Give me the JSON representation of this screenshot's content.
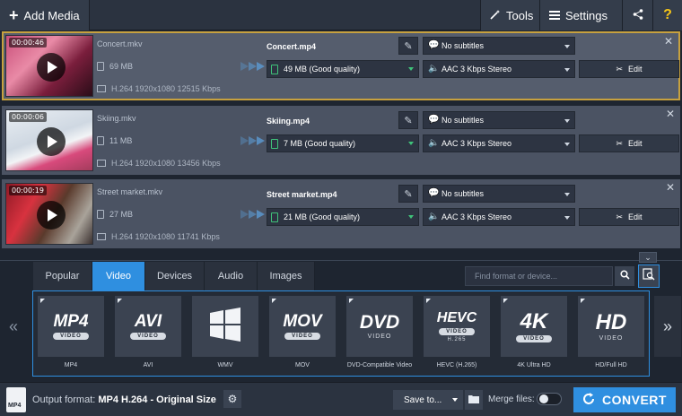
{
  "toolbar": {
    "add_media": "Add Media",
    "tools": "Tools",
    "settings": "Settings",
    "help": "?"
  },
  "rows": [
    {
      "duration": "00:00:46",
      "source_name": "Concert.mkv",
      "source_size": "69 MB",
      "source_info": "H.264 1920x1080 12515 Kbps",
      "output_name": "Concert.mp4",
      "output_quality": "49 MB (Good quality)",
      "subtitles": "No subtitles",
      "audio": "AAC 3 Kbps Stereo",
      "edit": "Edit"
    },
    {
      "duration": "00:00:06",
      "source_name": "Skiing.mkv",
      "source_size": "11 MB",
      "source_info": "H.264 1920x1080 13456 Kbps",
      "output_name": "Skiing.mp4",
      "output_quality": "7 MB (Good quality)",
      "subtitles": "No subtitles",
      "audio": "AAC 3 Kbps Stereo",
      "edit": "Edit"
    },
    {
      "duration": "00:00:19",
      "source_name": "Street market.mkv",
      "source_size": "27 MB",
      "source_info": "H.264 1920x1080 11741 Kbps",
      "output_name": "Street market.mp4",
      "output_quality": "21 MB (Good quality)",
      "subtitles": "No subtitles",
      "audio": "AAC 3 Kbps Stereo",
      "edit": "Edit"
    }
  ],
  "tabs": [
    "Popular",
    "Video",
    "Devices",
    "Audio",
    "Images"
  ],
  "active_tab": "Video",
  "search": {
    "placeholder": "Find format or device..."
  },
  "formats": [
    {
      "big": "MP4",
      "sub": "VIDEO",
      "label": "MP4"
    },
    {
      "big": "AVI",
      "sub": "VIDEO",
      "label": "AVI"
    },
    {
      "big": "",
      "sub": "",
      "label": "WMV"
    },
    {
      "big": "MOV",
      "sub": "VIDEO",
      "label": "MOV"
    },
    {
      "big": "DVD",
      "sub": "VIDEO",
      "label": "DVD-Compatible Video"
    },
    {
      "big": "HEVC",
      "sub": "VIDEO",
      "sub2": "H.265",
      "label": "HEVC (H.265)"
    },
    {
      "big": "4K",
      "sub": "VIDEO",
      "label": "4K Ultra HD"
    },
    {
      "big": "HD",
      "sub2": "VIDEO",
      "label": "HD/Full HD"
    }
  ],
  "bottom": {
    "output_label": "Output format:",
    "output_value": "MP4 H.264 - Original Size",
    "output_icon_text": "MP4",
    "save_to": "Save to...",
    "merge_label": "Merge files:",
    "convert": "CONVERT"
  },
  "colors": {
    "accent": "#2f8fe0",
    "selected_border": "#c7a13f",
    "quality_green": "#3fc37a"
  }
}
